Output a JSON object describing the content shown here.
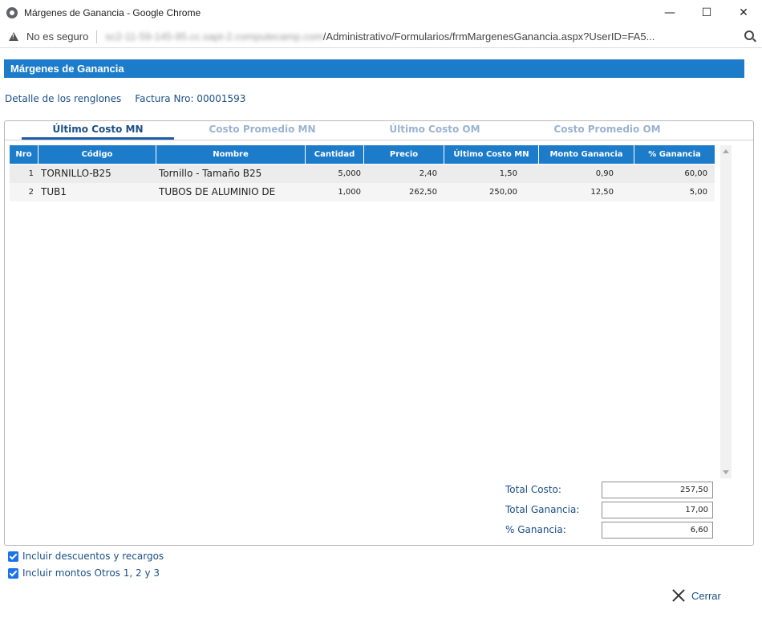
{
  "window": {
    "title": "Márgenes de Ganancia - Google Chrome",
    "minimize_glyph": "—",
    "maximize_glyph": "☐",
    "close_glyph": "✕"
  },
  "address": {
    "security_label": "No es seguro",
    "url_host": "sc2-11-59-145-95.cc.sapt-2.computecamp.com",
    "url_path": "/Administrativo/Formularios/frmMargenesGanancia.aspx?UserID=FA5..."
  },
  "page": {
    "header_title": "Márgenes de Ganancia",
    "detail_label": "Detalle de los renglones",
    "invoice_label": "Factura Nro: 00001593"
  },
  "tabs": [
    {
      "label": "Último Costo MN",
      "active": true
    },
    {
      "label": "Costo Promedio MN",
      "active": false
    },
    {
      "label": "Último Costo OM",
      "active": false
    },
    {
      "label": "Costo Promedio OM",
      "active": false
    }
  ],
  "table": {
    "columns": [
      "Nro",
      "Código",
      "Nombre",
      "Cantidad",
      "Precio",
      "Último Costo MN",
      "Monto Ganancia",
      "% Ganancia"
    ],
    "rows": [
      {
        "nro": "1",
        "codigo": "TORNILLO-B25",
        "nombre": "Tornillo - Tamaño B25",
        "cantidad": "5,000",
        "precio": "2,40",
        "ultimo_costo": "1,50",
        "monto_ganancia": "0,90",
        "pct_ganancia": "60,00"
      },
      {
        "nro": "2",
        "codigo": "TUB1",
        "nombre": "TUBOS DE ALUMINIO DE",
        "cantidad": "1,000",
        "precio": "262,50",
        "ultimo_costo": "250,00",
        "monto_ganancia": "12,50",
        "pct_ganancia": "5,00"
      }
    ]
  },
  "totals": {
    "total_costo_label": "Total Costo:",
    "total_costo_value": "257,50",
    "total_ganancia_label": "Total Ganancia:",
    "total_ganancia_value": "17,00",
    "pct_ganancia_label": "% Ganancia:",
    "pct_ganancia_value": "6,60"
  },
  "options": [
    {
      "label": "Incluir descuentos y recargos",
      "checked": true
    },
    {
      "label": "Incluir montos Otros 1, 2 y 3",
      "checked": true
    }
  ],
  "actions": {
    "close_label": "Cerrar"
  },
  "colors": {
    "header_blue": "#1d7cc9",
    "text_blue": "#1a4f87"
  }
}
